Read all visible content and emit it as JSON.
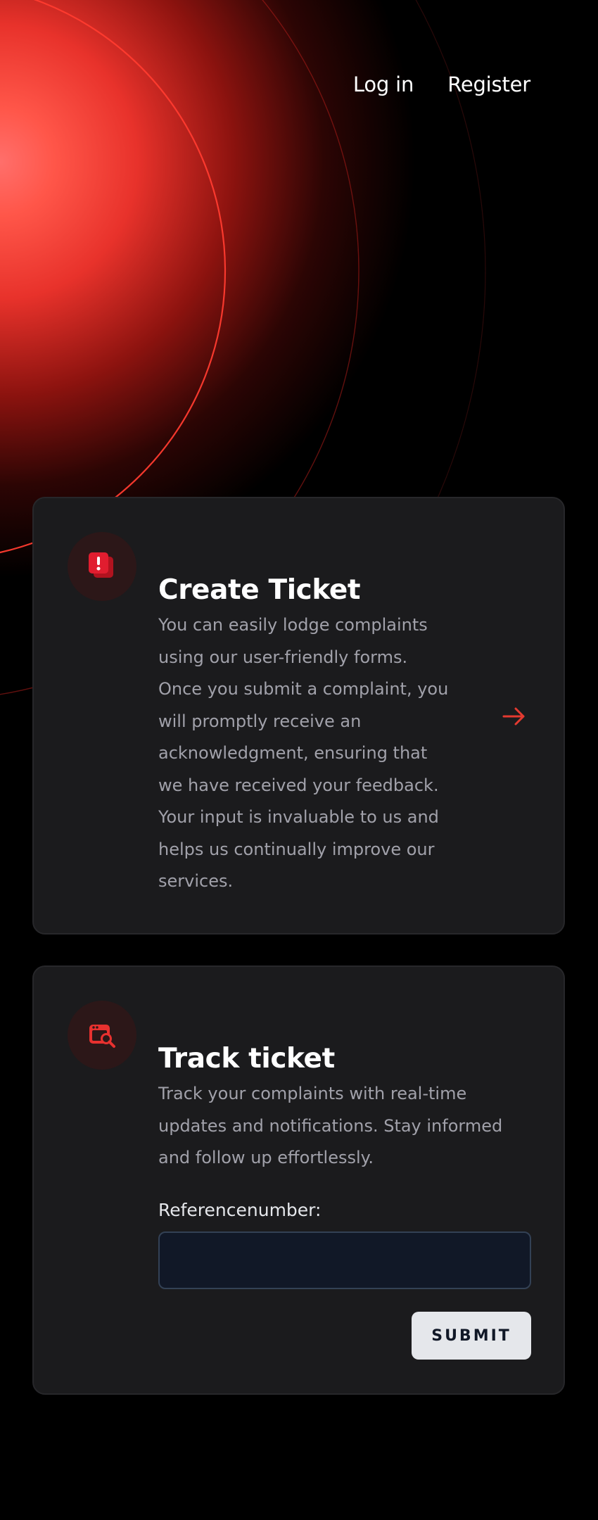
{
  "nav": {
    "login": "Log in",
    "register": "Register"
  },
  "cards": {
    "create": {
      "icon": "alert-ticket-icon",
      "title": "Create Ticket",
      "description": "You can easily lodge complaints using our user-friendly forms. Once you submit a complaint, you will promptly receive an acknowledgment, ensuring that we have received your feedback. Your input is invaluable to us and helps us continually improve our services.",
      "action_icon": "arrow-right-icon"
    },
    "track": {
      "icon": "track-search-icon",
      "title": "Track ticket",
      "description": "Track your complaints with real-time updates and notifications. Stay informed and follow up effortlessly.",
      "reference_label": "Referencenumber:",
      "reference_value": "",
      "submit": "SUBMIT"
    }
  },
  "colors": {
    "accent": "#E43A30",
    "background": "#000000",
    "card": "#1B1B1D",
    "muted_text": "#A1A1AA",
    "button": "#E5E7EB"
  }
}
